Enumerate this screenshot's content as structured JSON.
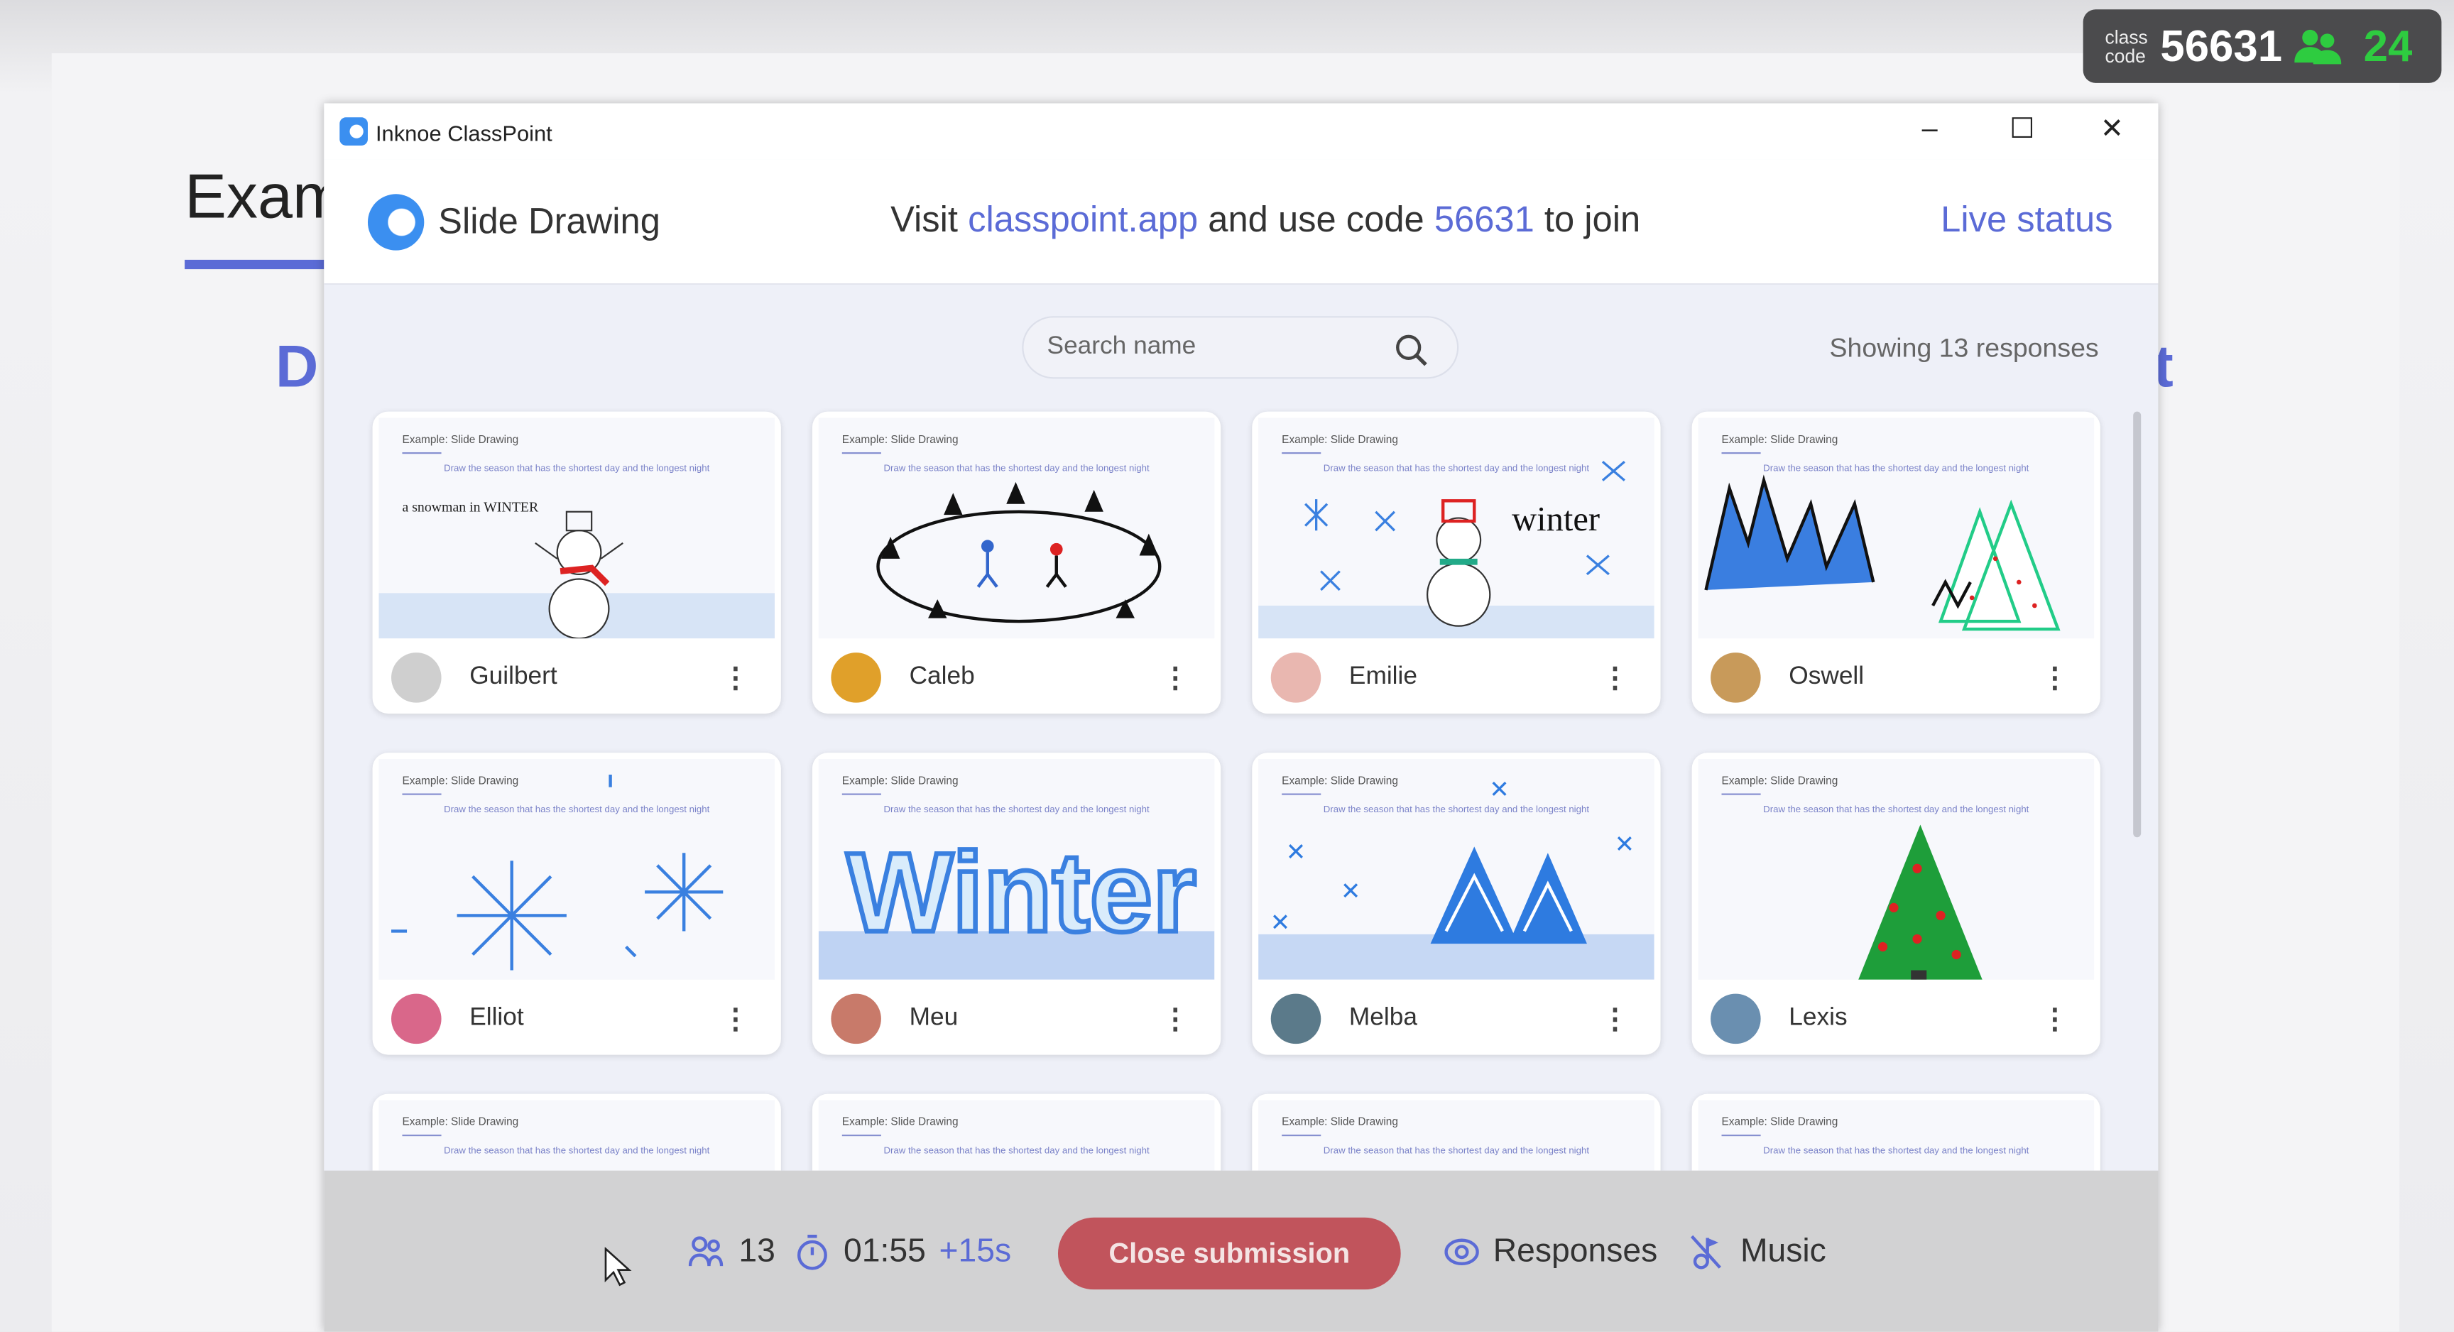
{
  "slide_bg": {
    "title_fragment": "Exam",
    "left_fragment": "D",
    "right_fragment": "t"
  },
  "badge": {
    "label_line1": "class",
    "label_line2": "code",
    "code": "56631",
    "participants": "24",
    "participants_color": "#2ecc40"
  },
  "window": {
    "title": "Inknoe ClassPoint",
    "minimize": "–",
    "maximize": "☐",
    "close": "✕"
  },
  "header": {
    "activity": "Slide Drawing",
    "visit_prefix": "Visit",
    "site": "classpoint.app",
    "visit_mid": "and use code",
    "code": "56631",
    "visit_suffix": "to join",
    "live_status": "Live status",
    "accent": "#5b6bd6"
  },
  "search": {
    "placeholder": "Search name",
    "value": ""
  },
  "showing": "Showing 13 responses",
  "slide_meta": {
    "title": "Example: Slide Drawing",
    "prompt": "Draw the season that has the shortest day and the longest night"
  },
  "cards": [
    {
      "name": "Guilbert",
      "drawing_text": "a snowman in WINTER",
      "avatar_color": "#cfcfcf"
    },
    {
      "name": "Caleb",
      "drawing_text": "",
      "avatar_color": "#e0a02a"
    },
    {
      "name": "Emilie",
      "drawing_text": "winter",
      "avatar_color": "#e9b7b0"
    },
    {
      "name": "Oswell",
      "drawing_text": "",
      "avatar_color": "#c89a5a"
    },
    {
      "name": "Elliot",
      "drawing_text": "",
      "avatar_color": "#d9678a"
    },
    {
      "name": "Meu",
      "drawing_text": "Winter",
      "avatar_color": "#c87a6a"
    },
    {
      "name": "Melba",
      "drawing_text": "",
      "avatar_color": "#5b7a8a"
    },
    {
      "name": "Lexis",
      "drawing_text": "",
      "avatar_color": "#6a8fb0"
    },
    {
      "name": "",
      "drawing_text": ""
    },
    {
      "name": "",
      "drawing_text": ""
    },
    {
      "name": "",
      "drawing_text": ""
    },
    {
      "name": "",
      "drawing_text": ""
    }
  ],
  "footer": {
    "count": "13",
    "timer": "01:55",
    "extend": "+15s",
    "close_button": "Close submission",
    "responses": "Responses",
    "music": "Music",
    "close_color": "#c1545c"
  }
}
